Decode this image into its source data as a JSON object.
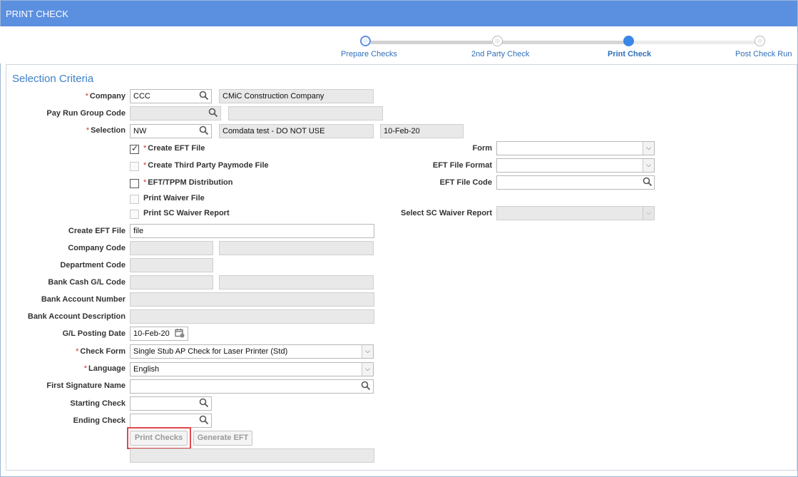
{
  "window": {
    "title": "PRINT CHECK"
  },
  "train": {
    "steps": [
      {
        "label": "Prepare Checks",
        "state": "visited"
      },
      {
        "label": "2nd Party Check",
        "state": "future"
      },
      {
        "label": "Print Check",
        "state": "current"
      },
      {
        "label": "Post Check Run",
        "state": "future"
      }
    ]
  },
  "section": {
    "title": "Selection Criteria"
  },
  "form": {
    "company": {
      "label": "Company",
      "required": "*",
      "value": "CCC",
      "description": "CMiC Construction Company"
    },
    "pay_run_group_code": {
      "label": "Pay Run Group Code",
      "value": "",
      "description": ""
    },
    "selection": {
      "label": "Selection",
      "required": "*",
      "value": "NW",
      "description": "Comdata test - DO NOT USE",
      "date": "10-Feb-20"
    },
    "create_eft_file_chk": {
      "label": "Create EFT File",
      "required": "*",
      "checked": true
    },
    "create_third_party_chk": {
      "label": "Create Third Party Paymode File",
      "required": "*",
      "checked": false
    },
    "eft_tppm_chk": {
      "label": "EFT/TPPM Distribution",
      "required": "*",
      "checked": false
    },
    "print_waiver_chk": {
      "label": "Print Waiver File",
      "checked": false
    },
    "print_sc_waiver_chk": {
      "label": "Print SC Waiver Report",
      "checked": false
    },
    "form_select": {
      "label": "Form",
      "value": ""
    },
    "eft_file_format": {
      "label": "EFT File Format",
      "value": ""
    },
    "eft_file_code": {
      "label": "EFT File Code",
      "value": ""
    },
    "select_sc_waiver_report": {
      "label": "Select SC Waiver Report",
      "value": ""
    },
    "create_eft_file": {
      "label": "Create EFT File",
      "value": "file"
    },
    "company_code": {
      "label": "Company Code",
      "value": "",
      "description": ""
    },
    "department_code": {
      "label": "Department Code",
      "value": ""
    },
    "bank_cash_gl_code": {
      "label": "Bank Cash G/L Code",
      "value": "",
      "description": ""
    },
    "bank_account_number": {
      "label": "Bank Account Number",
      "value": ""
    },
    "bank_account_description": {
      "label": "Bank Account Description",
      "value": ""
    },
    "gl_posting_date": {
      "label": "G/L Posting Date",
      "value": "10-Feb-20"
    },
    "check_form": {
      "label": "Check Form",
      "required": "*",
      "value": "Single Stub AP Check for Laser Printer (Std)"
    },
    "language": {
      "label": "Language",
      "required": "*",
      "value": "English"
    },
    "first_signature_name": {
      "label": "First Signature Name",
      "value": ""
    },
    "starting_check": {
      "label": "Starting Check",
      "value": ""
    },
    "ending_check": {
      "label": "Ending Check",
      "value": ""
    },
    "status_message": {
      "value": ""
    }
  },
  "buttons": {
    "print_checks": "Print Checks",
    "generate_eft": "Generate EFT"
  },
  "icons": {
    "search": "search-icon",
    "dropdown": "chevron-down-icon",
    "calendar": "calendar-icon",
    "checkmark": "checkmark-icon"
  },
  "colors": {
    "titlebar": "#5b8fe0",
    "accent": "#3a87e6",
    "highlight": "#e0474c"
  }
}
